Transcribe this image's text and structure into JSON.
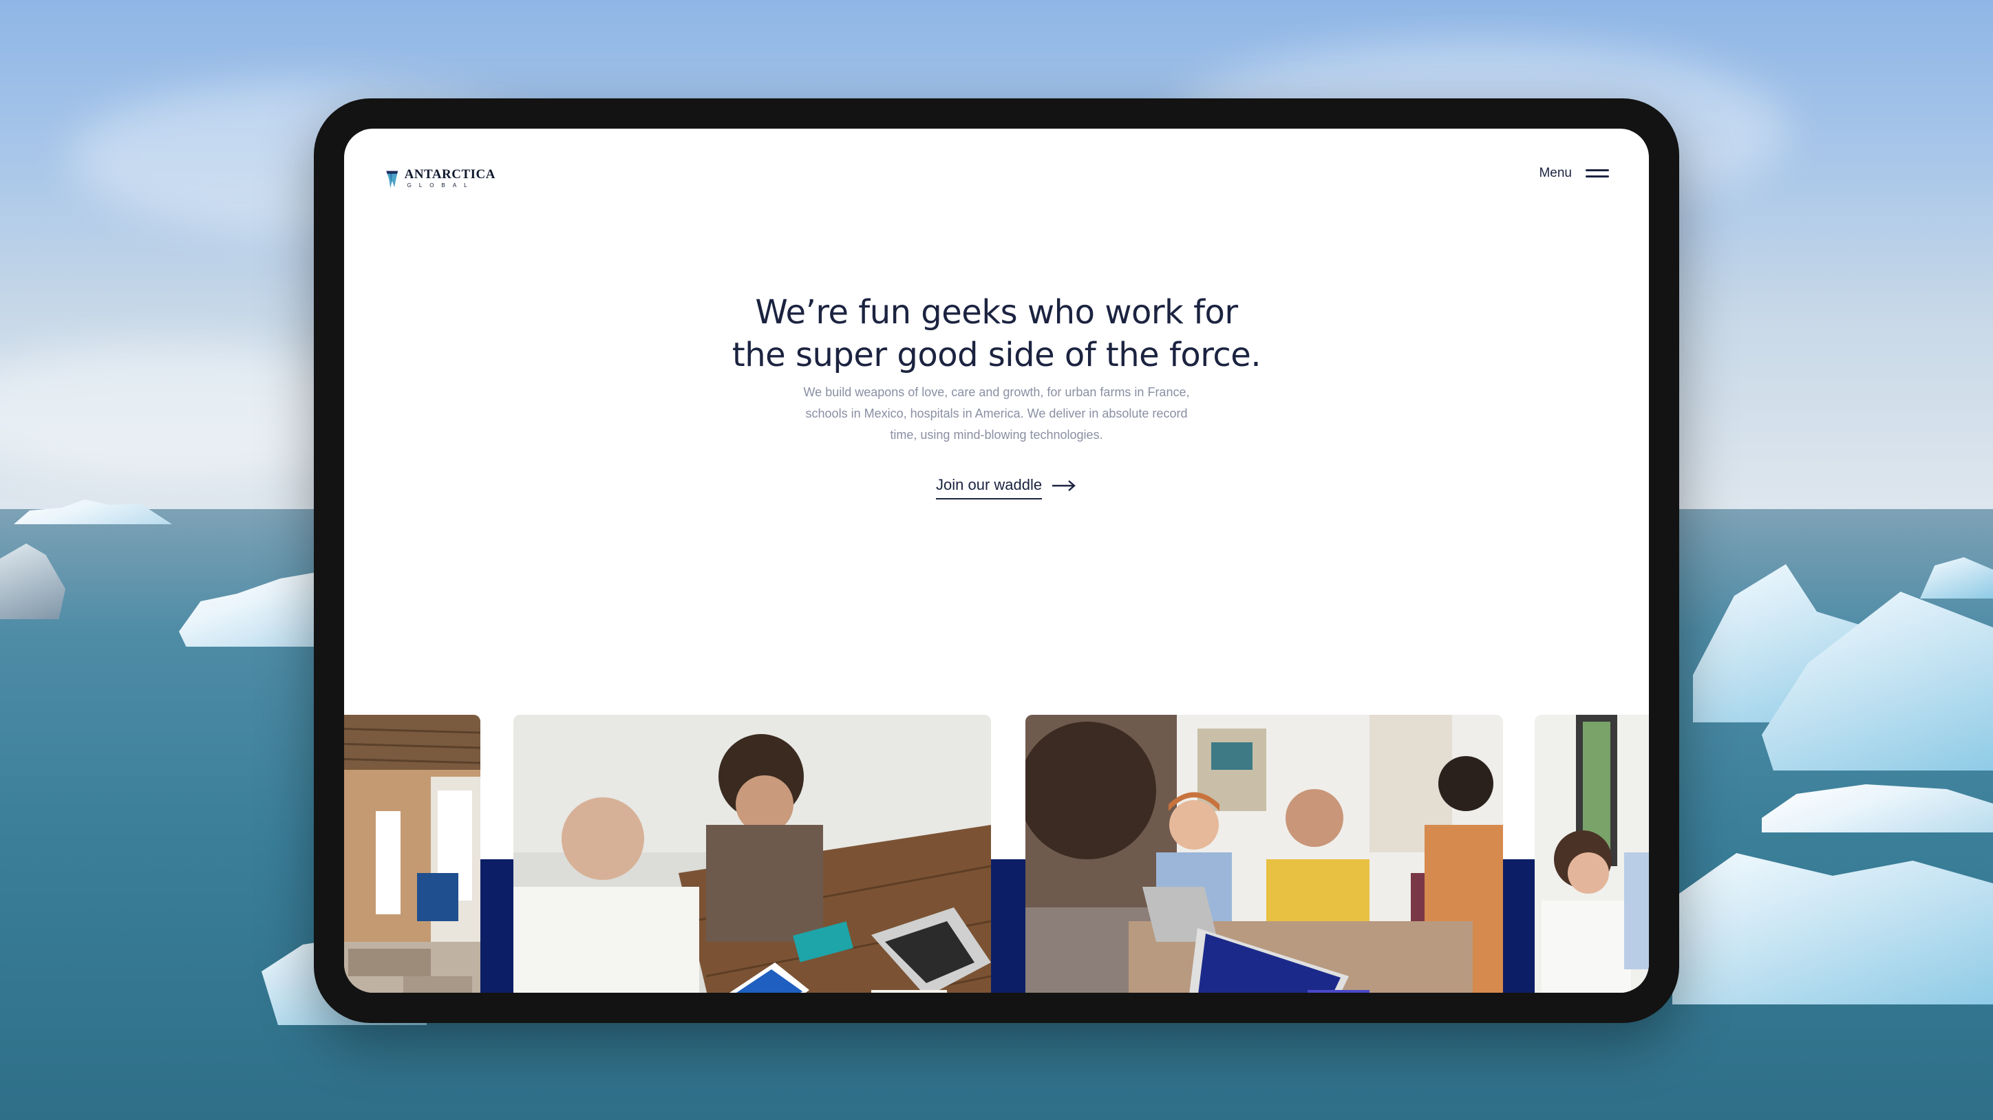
{
  "header": {
    "logo": {
      "word": "ANTARCTICA",
      "sub": "GLOBAL"
    },
    "menu_label": "Menu"
  },
  "hero": {
    "title_line1": "We’re fun geeks who work for",
    "title_line2": "the super good side of the force.",
    "subtitle_line1": "We build weapons of love, care and growth, for urban farms in France,",
    "subtitle_line2": "schools in Mexico, hospitals in America. We deliver in absolute record",
    "subtitle_line3": "time, using mind-blowing technologies.",
    "cta_label": "Join our waddle"
  },
  "gallery": [
    {
      "alt": "office interior"
    },
    {
      "alt": "two people working at wooden table"
    },
    {
      "alt": "team meeting with laptops"
    },
    {
      "alt": "woman at laptop"
    }
  ],
  "colors": {
    "navy": "#0c1f66",
    "text_dark": "#1b2340",
    "text_muted": "#8a8fa3",
    "device_frame": "#131313"
  },
  "icons": [
    "logo-mark-icon",
    "menu-icon",
    "arrow-right-icon"
  ]
}
